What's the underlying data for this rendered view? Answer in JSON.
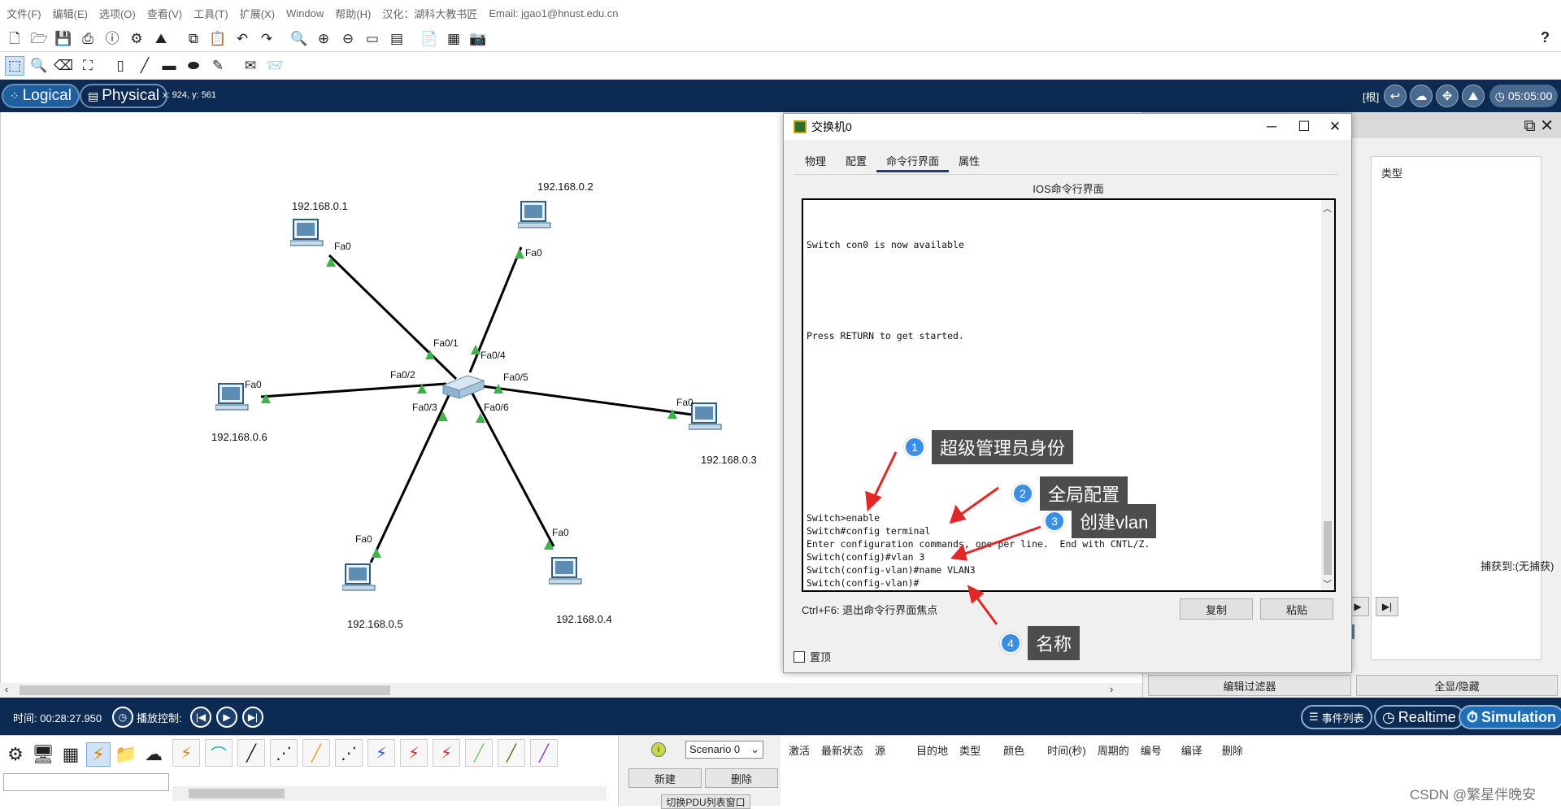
{
  "menu": [
    "文件(F)",
    "编辑(E)",
    "选项(O)",
    "查看(V)",
    "工具(T)",
    "扩展(X)",
    "Window",
    "帮助(H)",
    "汉化：湖科大教书匠",
    "Email: jgao1@hnust.edu.cn"
  ],
  "toolbar": {
    "help": "?"
  },
  "nav": {
    "logical": "Logical",
    "physical": "Physical",
    "coords": "x: 924, y: 561",
    "root": "[根]",
    "clock": "05:05:00"
  },
  "topology": {
    "pcs": [
      {
        "ip": "192.168.0.1",
        "port": "Fa0",
        "switch_port": "Fa0/1"
      },
      {
        "ip": "192.168.0.2",
        "port": "Fa0",
        "switch_port": "Fa0/4"
      },
      {
        "ip": "192.168.0.6",
        "port": "Fa0",
        "switch_port": "Fa0/2"
      },
      {
        "ip": "192.168.0.3",
        "port": "Fa0",
        "switch_port": "Fa0/5"
      },
      {
        "ip": "192.168.0.5",
        "port": "Fa0",
        "switch_port": "Fa0/3"
      },
      {
        "ip": "192.168.0.4",
        "port": "Fa0",
        "switch_port": "Fa0/6"
      }
    ]
  },
  "dialog": {
    "title": "交换机0",
    "tabs": [
      "物理",
      "配置",
      "命令行界面",
      "属性"
    ],
    "active_tab": "命令行界面",
    "heading": "IOS命令行界面",
    "terminal_lines": [
      "Switch con0 is now available",
      "Press RETURN to get started.",
      "Switch>enable",
      "Switch#config terminal",
      "Enter configuration commands, one per line.  End with CNTL/Z.",
      "Switch(config)#vlan 3",
      "Switch(config-vlan)#name VLAN3",
      "Switch(config-vlan)#"
    ],
    "hint": "Ctrl+F6:  退出命令行界面焦点",
    "copy": "复制",
    "paste": "粘贴",
    "on_top": "置顶"
  },
  "annotations": [
    {
      "num": "1",
      "text": "超级管理员身份"
    },
    {
      "num": "2",
      "text": "全局配置"
    },
    {
      "num": "3",
      "text": "创建vlan"
    },
    {
      "num": "4",
      "text": "名称"
    }
  ],
  "right_panel": {
    "type_col": "类型",
    "capture_to": "捕获到:(无捕获)",
    "edit_filter": "编辑过滤器",
    "show_hide": "全显/隐藏"
  },
  "timebar": {
    "time": "时间: 00:28:27.950",
    "play_control": "播放控制:",
    "event_list": "事件列表",
    "realtime": "Realtime",
    "simulation": "Simulation"
  },
  "bottom": {
    "scenario": "Scenario 0",
    "new": "新建",
    "delete": "删除",
    "switch_pdu": "切换PDU列表窗口",
    "pdu_columns": [
      "激活",
      "最新状态",
      "源",
      "目的地",
      "类型",
      "颜色",
      "时间(秒)",
      "周期的",
      "编号",
      "编译",
      "删除"
    ],
    "watermark": "CSDN @繁星伴晚安"
  },
  "colors": {
    "nav_bg": "#0d2b52",
    "link_green": "#3cb44b",
    "callout_blue": "#3a8ee6",
    "callout_bg": "#4d4d4d",
    "arrow_red": "#e32626"
  }
}
